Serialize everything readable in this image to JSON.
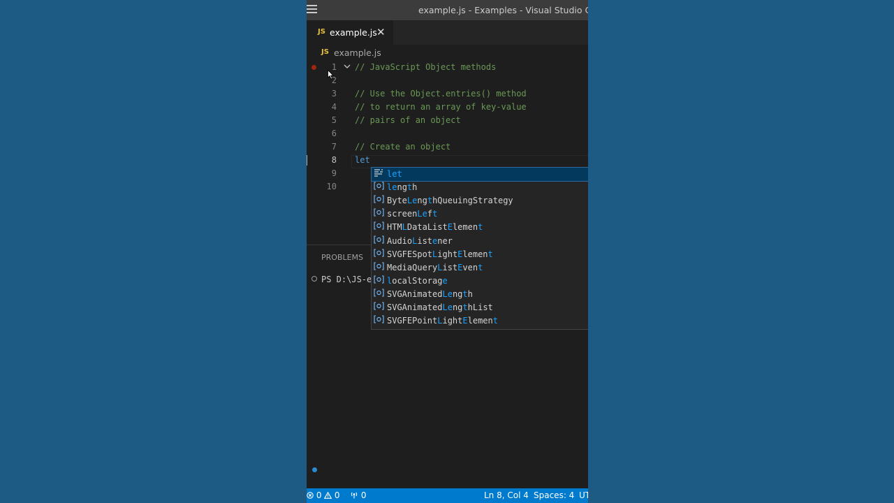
{
  "window": {
    "title": "example.js - Examples - Visual Studio Code"
  },
  "tab": {
    "icon_label": "JS",
    "name": "example.js",
    "close": "✕"
  },
  "breadcrumb": {
    "icon_label": "JS",
    "file": "example.js"
  },
  "editor": {
    "lines": [
      {
        "n": "1",
        "text": "// JavaScript Object methods"
      },
      {
        "n": "2",
        "text": ""
      },
      {
        "n": "3",
        "text": "// Use the Object.entries() method"
      },
      {
        "n": "4",
        "text": "// to return an array of key-value"
      },
      {
        "n": "5",
        "text": "// pairs of an object"
      },
      {
        "n": "6",
        "text": ""
      },
      {
        "n": "7",
        "text": "// Create an object"
      },
      {
        "n": "8",
        "text": "let"
      },
      {
        "n": "9",
        "text": ""
      },
      {
        "n": "10",
        "text": ""
      }
    ]
  },
  "suggestions": [
    {
      "icon": "keyword-icon",
      "label": "let"
    },
    {
      "icon": "variable-icon",
      "label": "length"
    },
    {
      "icon": "variable-icon",
      "label": "ByteLengthQueuingStrategy"
    },
    {
      "icon": "variable-icon",
      "label": "screenLeft"
    },
    {
      "icon": "variable-icon",
      "label": "HTMLDataListElement"
    },
    {
      "icon": "variable-icon",
      "label": "AudioListener"
    },
    {
      "icon": "variable-icon",
      "label": "SVGFESpotLightElement"
    },
    {
      "icon": "variable-icon",
      "label": "MediaQueryListEvent"
    },
    {
      "icon": "variable-icon",
      "label": "localStorage"
    },
    {
      "icon": "variable-icon",
      "label": "SVGAnimatedLength"
    },
    {
      "icon": "variable-icon",
      "label": "SVGAnimatedLengthList"
    },
    {
      "icon": "variable-icon",
      "label": "SVGFEPointLightElement"
    }
  ],
  "panel": {
    "problems_tab": "PROBLEMS",
    "terminal_text": "PS D:\\JS-e"
  },
  "statusbar": {
    "errors": "0",
    "warnings": "0",
    "ports": "0",
    "position": "Ln 8, Col 4",
    "spaces": "Spaces: 4",
    "encoding": "UT"
  },
  "colors": {
    "background": "#1d5a84",
    "statusbar": "#007acc",
    "comment": "#6a9955",
    "keyword": "#569cd6",
    "match": "#18a3ff"
  }
}
